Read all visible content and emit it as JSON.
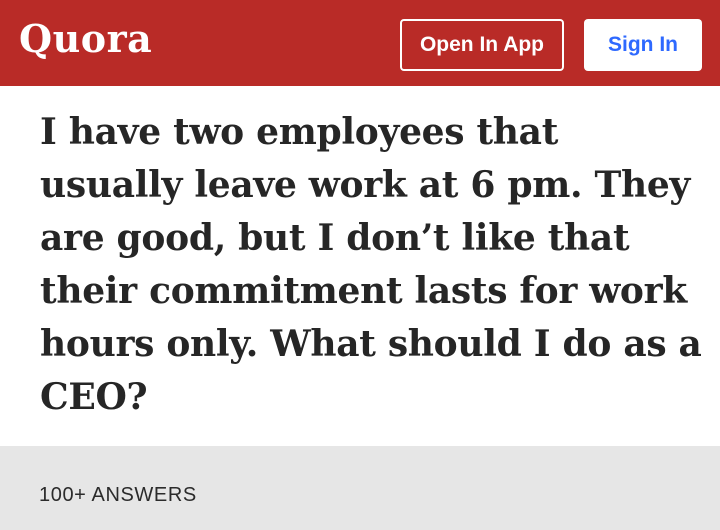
{
  "header": {
    "logo_text": "Quora",
    "open_in_app_label": "Open In App",
    "sign_in_label": "Sign In"
  },
  "question": {
    "text": "I have two employees that usually leave work at 6 pm. They are good, but I don’t like that their commitment lasts for work hours only. What should I do as a CEO?"
  },
  "answers": {
    "count_label": "100+ ANSWERS"
  },
  "colors": {
    "brand_red": "#b92b27",
    "sign_in_text": "#2e69ff",
    "answers_bar_bg": "#e6e6e6"
  }
}
